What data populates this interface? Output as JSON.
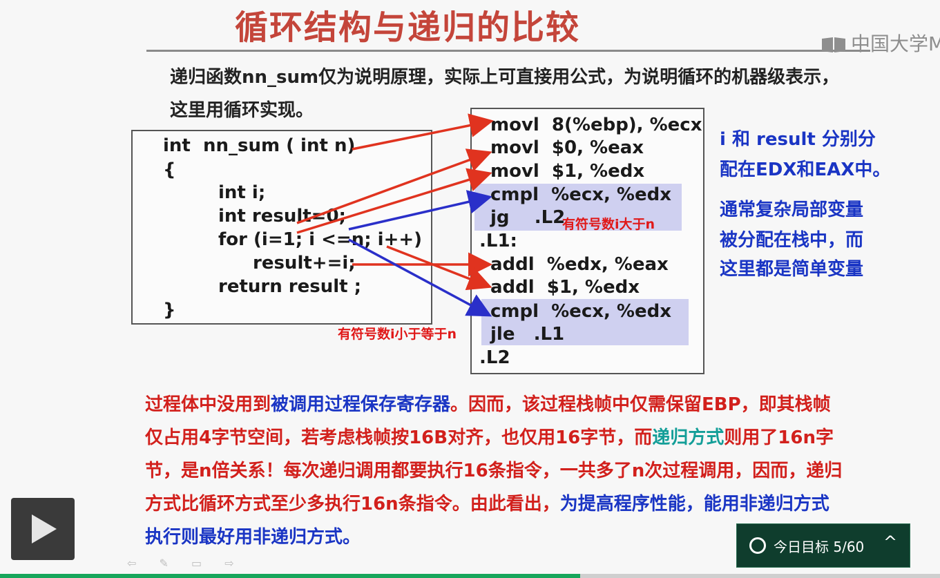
{
  "slide": {
    "title": "循环结构与递归的比较",
    "logo_text": "中国大学M",
    "intro": "递归函数nn_sum仅为说明原理，实际上可直接用公式，为说明循环的机器级表示，这里用循环实现。"
  },
  "c_code": {
    "lines": [
      "int  nn_sum ( int n)",
      "{",
      "int i;",
      "int result=0;",
      "for (i=1; i <=n; i++)",
      "result+=i;",
      "return result ;",
      "}"
    ]
  },
  "asm_code": {
    "lines": [
      "movl  8(%ebp), %ecx",
      "movl  $0, %eax",
      "movl  $1, %edx",
      "cmpl  %ecx, %edx",
      "jg    .L2",
      ".L1:",
      "addl  %edx, %eax",
      "addl  $1, %edx",
      "cmpl  %ecx, %edx",
      "jle   .L1",
      ".L2"
    ]
  },
  "labels": {
    "jg_note": "有符号数i大于n",
    "jle_note": "有符号数i小于等于n"
  },
  "side_notes": {
    "note1_l1": "i 和 result 分别分",
    "note1_l2": "配在EDX和EAX中。",
    "note2_l1": "通常复杂局部变量",
    "note2_l2": "被分配在栈中，而",
    "note2_l3": "这里都是简单变量"
  },
  "paragraph": {
    "p1_red": "过程体中没用到",
    "p1_blue": "被调用过程保存寄存器",
    "p1_red2": "。因而，该过程栈帧中仅需保留EBP，即其栈帧仅占用4字节空间，若考虑栈帧按16B对齐，也仅用16字节，而",
    "p1_teal": "递归方式",
    "p1_red3": "则用了16n字节，是n倍关系！每次递归调用都要执行16条指令，一共多了n次过程调用，因而，递归方式比循环方式至少多执行16n条指令。由此看出，",
    "p1_blue2": "为提高程序性能，能用非递归方式执行则最好用非递归方式。"
  },
  "player": {
    "goal_label": "今日目标 5/60",
    "progress": 0.617,
    "colors": {
      "accent": "#17a65b",
      "goal_bg": "#0f3d2d"
    }
  }
}
